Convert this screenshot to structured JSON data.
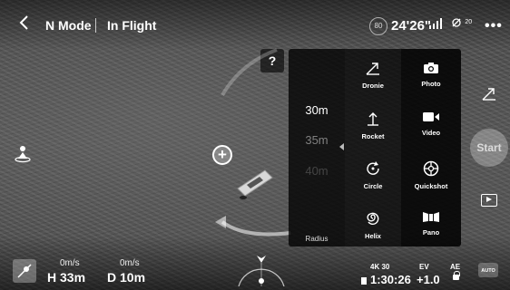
{
  "topbar": {
    "back_icon": "chevron-left-icon",
    "mode": "N Mode",
    "flight_status": "In Flight",
    "battery_percent": "80",
    "time_remaining": "24'26\"",
    "signal_icon": "signal-bars-icon",
    "satellite_count": "20",
    "more_icon": "more-dots-icon"
  },
  "help": {
    "label": "?"
  },
  "radius": {
    "options": [
      "30m",
      "35m",
      "40m"
    ],
    "selected": "30m",
    "label": "Radius"
  },
  "quickshot_modes": [
    {
      "label": "Dronie",
      "icon": "dronie-icon"
    },
    {
      "label": "Rocket",
      "icon": "rocket-icon"
    },
    {
      "label": "Circle",
      "icon": "circle-icon"
    },
    {
      "label": "Helix",
      "icon": "helix-icon"
    }
  ],
  "shot_types": [
    {
      "label": "Photo",
      "icon": "camera-icon"
    },
    {
      "label": "Video",
      "icon": "video-icon"
    },
    {
      "label": "Quickshot",
      "icon": "quickshot-icon"
    },
    {
      "label": "Pano",
      "icon": "pano-icon"
    }
  ],
  "right_rail": {
    "start_label": "Start",
    "auto_label": "AUTO"
  },
  "telemetry": {
    "horizontal_speed": "0m/s",
    "height": "H 33m",
    "vertical_speed": "0m/s",
    "distance": "D 10m"
  },
  "camera": {
    "resolution": "4K 30",
    "record_time": "1:30:26",
    "ev_label": "EV",
    "ev_value": "+1.0",
    "ae_label": "AE"
  },
  "colors": {
    "panel_bg": "#000000",
    "text": "#ffffff"
  }
}
